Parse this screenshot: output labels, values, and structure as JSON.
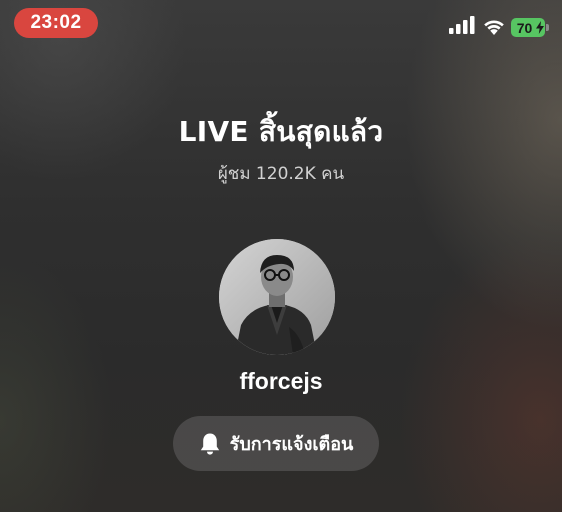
{
  "status_bar": {
    "time": "23:02",
    "battery_level": "70",
    "icons": [
      "cellular-signal-icon",
      "wifi-icon",
      "battery-charging-icon"
    ],
    "colors": {
      "time_pill": "#d9463f",
      "battery": "#57c562"
    }
  },
  "live": {
    "title": "LIVE สิ้นสุดแล้ว",
    "viewers": "ผู้ชม 120.2K คน"
  },
  "profile": {
    "username": "fforcejs"
  },
  "notify_button": {
    "label": "รับการแจ้งเตือน",
    "icon": "bell-icon"
  }
}
